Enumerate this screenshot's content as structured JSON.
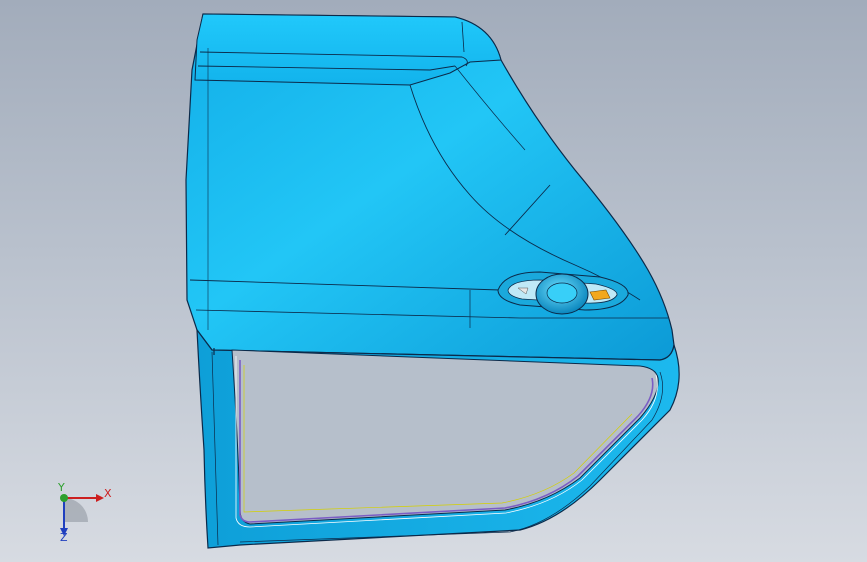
{
  "viewport": {
    "background_top": "#a2acbb",
    "background_bottom": "#d7dbe2"
  },
  "model": {
    "part": "car-door-panel",
    "surface_color": "#18b8ee",
    "edge_color": "#0b2a4a",
    "handle_accent": "#f2a81d"
  },
  "triad": {
    "x_label": "X",
    "y_label": "Y",
    "z_label": "Z",
    "x_color": "#cc1f1f",
    "y_color": "#2ea02e",
    "z_color": "#1f3fbf"
  }
}
